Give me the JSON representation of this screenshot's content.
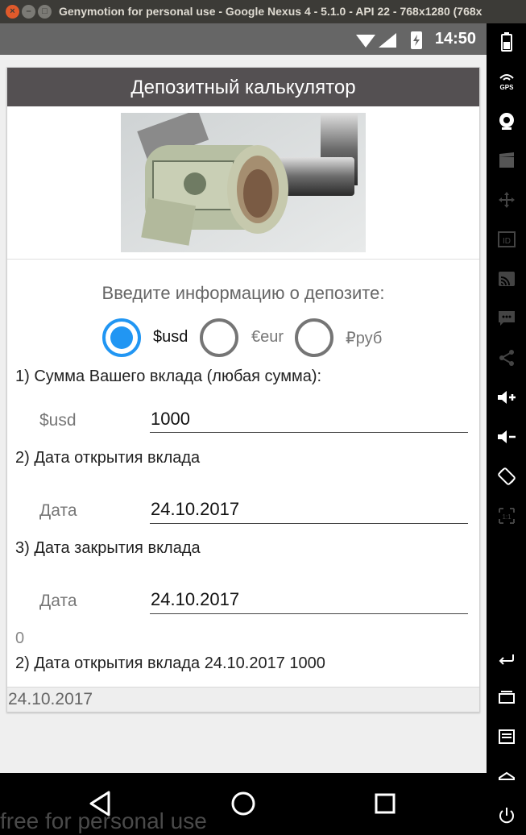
{
  "window": {
    "title": "Genymotion for personal use - Google Nexus 4 - 5.1.0 - API 22 - 768x1280 (768x"
  },
  "statusbar": {
    "time": "14:50"
  },
  "app": {
    "title": "Депозитный калькулятор",
    "prompt": "Введите информацию о депозите:",
    "currencies": [
      {
        "label": "$usd",
        "selected": true
      },
      {
        "label": "€eur",
        "selected": false
      },
      {
        "label": "₽руб",
        "selected": false
      }
    ],
    "q1": "1) Сумма Вашего вклада (любая сумма):",
    "amount_label": "$usd",
    "amount_value": "1000",
    "q2": "2) Дата открытия вклада",
    "open_label": "Дата",
    "open_value": "24.10.2017",
    "q3": "3) Дата закрытия вклада",
    "close_label": "Дата",
    "close_value": "24.10.2017",
    "result_zero": "0",
    "result_line": "2) Дата открытия вклада 24.10.2017 1000",
    "footer_date": "24.10.2017"
  },
  "watermark": "free for personal use",
  "icons": {
    "sidebar": [
      "battery-icon",
      "gps-icon",
      "camera-icon",
      "video-icon",
      "move-icon",
      "id-icon",
      "cast-icon",
      "sms-icon",
      "share-icon",
      "volume-up-icon",
      "volume-down-icon",
      "rotate-icon",
      "scale-icon",
      "back-icon",
      "recent-apps-icon",
      "menu-icon",
      "home-icon",
      "power-icon"
    ],
    "nav": [
      "back-triangle-icon",
      "home-circle-icon",
      "recent-square-icon"
    ]
  },
  "colors": {
    "accent": "#2196f3",
    "titlebar": "#545052"
  }
}
